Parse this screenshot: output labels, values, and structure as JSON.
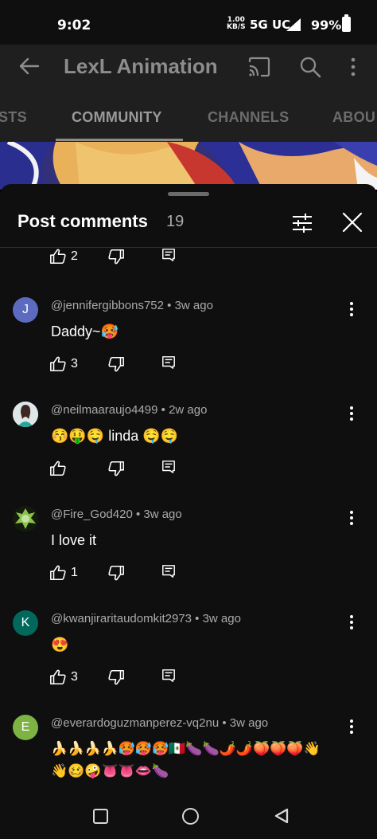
{
  "status": {
    "time": "9:02",
    "net_speed": "1.00",
    "net_unit": "KB/S",
    "network": "5G UC",
    "battery": "99%"
  },
  "header": {
    "channel_title": "LexL Animation",
    "tabs": [
      {
        "label": "STS"
      },
      {
        "label": "COMMUNITY"
      },
      {
        "label": "CHANNELS"
      },
      {
        "label": "ABOU"
      }
    ]
  },
  "sheet": {
    "title": "Post comments",
    "count": "19"
  },
  "top_partial": {
    "like_count": "2"
  },
  "comments": [
    {
      "avatar_letter": "J",
      "avatar_color": "#5c6bc0",
      "username": "@jenniferg​ibbons752",
      "age": "3w ago",
      "text": "Daddy~🥵",
      "likes": "3"
    },
    {
      "avatar_letter": "",
      "avatar_color": "#cfd8dc",
      "username": "@neilmaaraujo4499",
      "age": "2w ago",
      "text": "😚🤑🤤 linda 🤤🤤",
      "likes": ""
    },
    {
      "avatar_letter": "",
      "avatar_color": "#33691e",
      "username": "@Fire_God420",
      "age": "3w ago",
      "text": "I love it",
      "likes": "1"
    },
    {
      "avatar_letter": "K",
      "avatar_color": "#00695c",
      "username": "@kwanjiraritaudomkit2973",
      "age": "3w ago",
      "text": "😍",
      "likes": "3"
    },
    {
      "avatar_letter": "E",
      "avatar_color": "#7cb342",
      "username": "@everardoguzmanperez-vq2nu",
      "age": "3w ago",
      "text": "🍌🍌🍌🍌🥵🥵🥵🇲🇽🍆🍆🌶️🌶️🍑🍑🍑👋",
      "text2": "👋🥴🤪👅👅👄🍆",
      "likes": ""
    }
  ],
  "colors": {
    "sheet_bg": "#0f0f0f",
    "header_bg": "#1f1f1f",
    "meta_text": "#aaaaaa"
  },
  "icons": [
    "back-arrow-icon",
    "cast-icon",
    "search-icon",
    "more-vert-icon",
    "filter-icon",
    "close-icon",
    "thumb-up-icon",
    "thumb-down-icon",
    "reply-icon"
  ]
}
